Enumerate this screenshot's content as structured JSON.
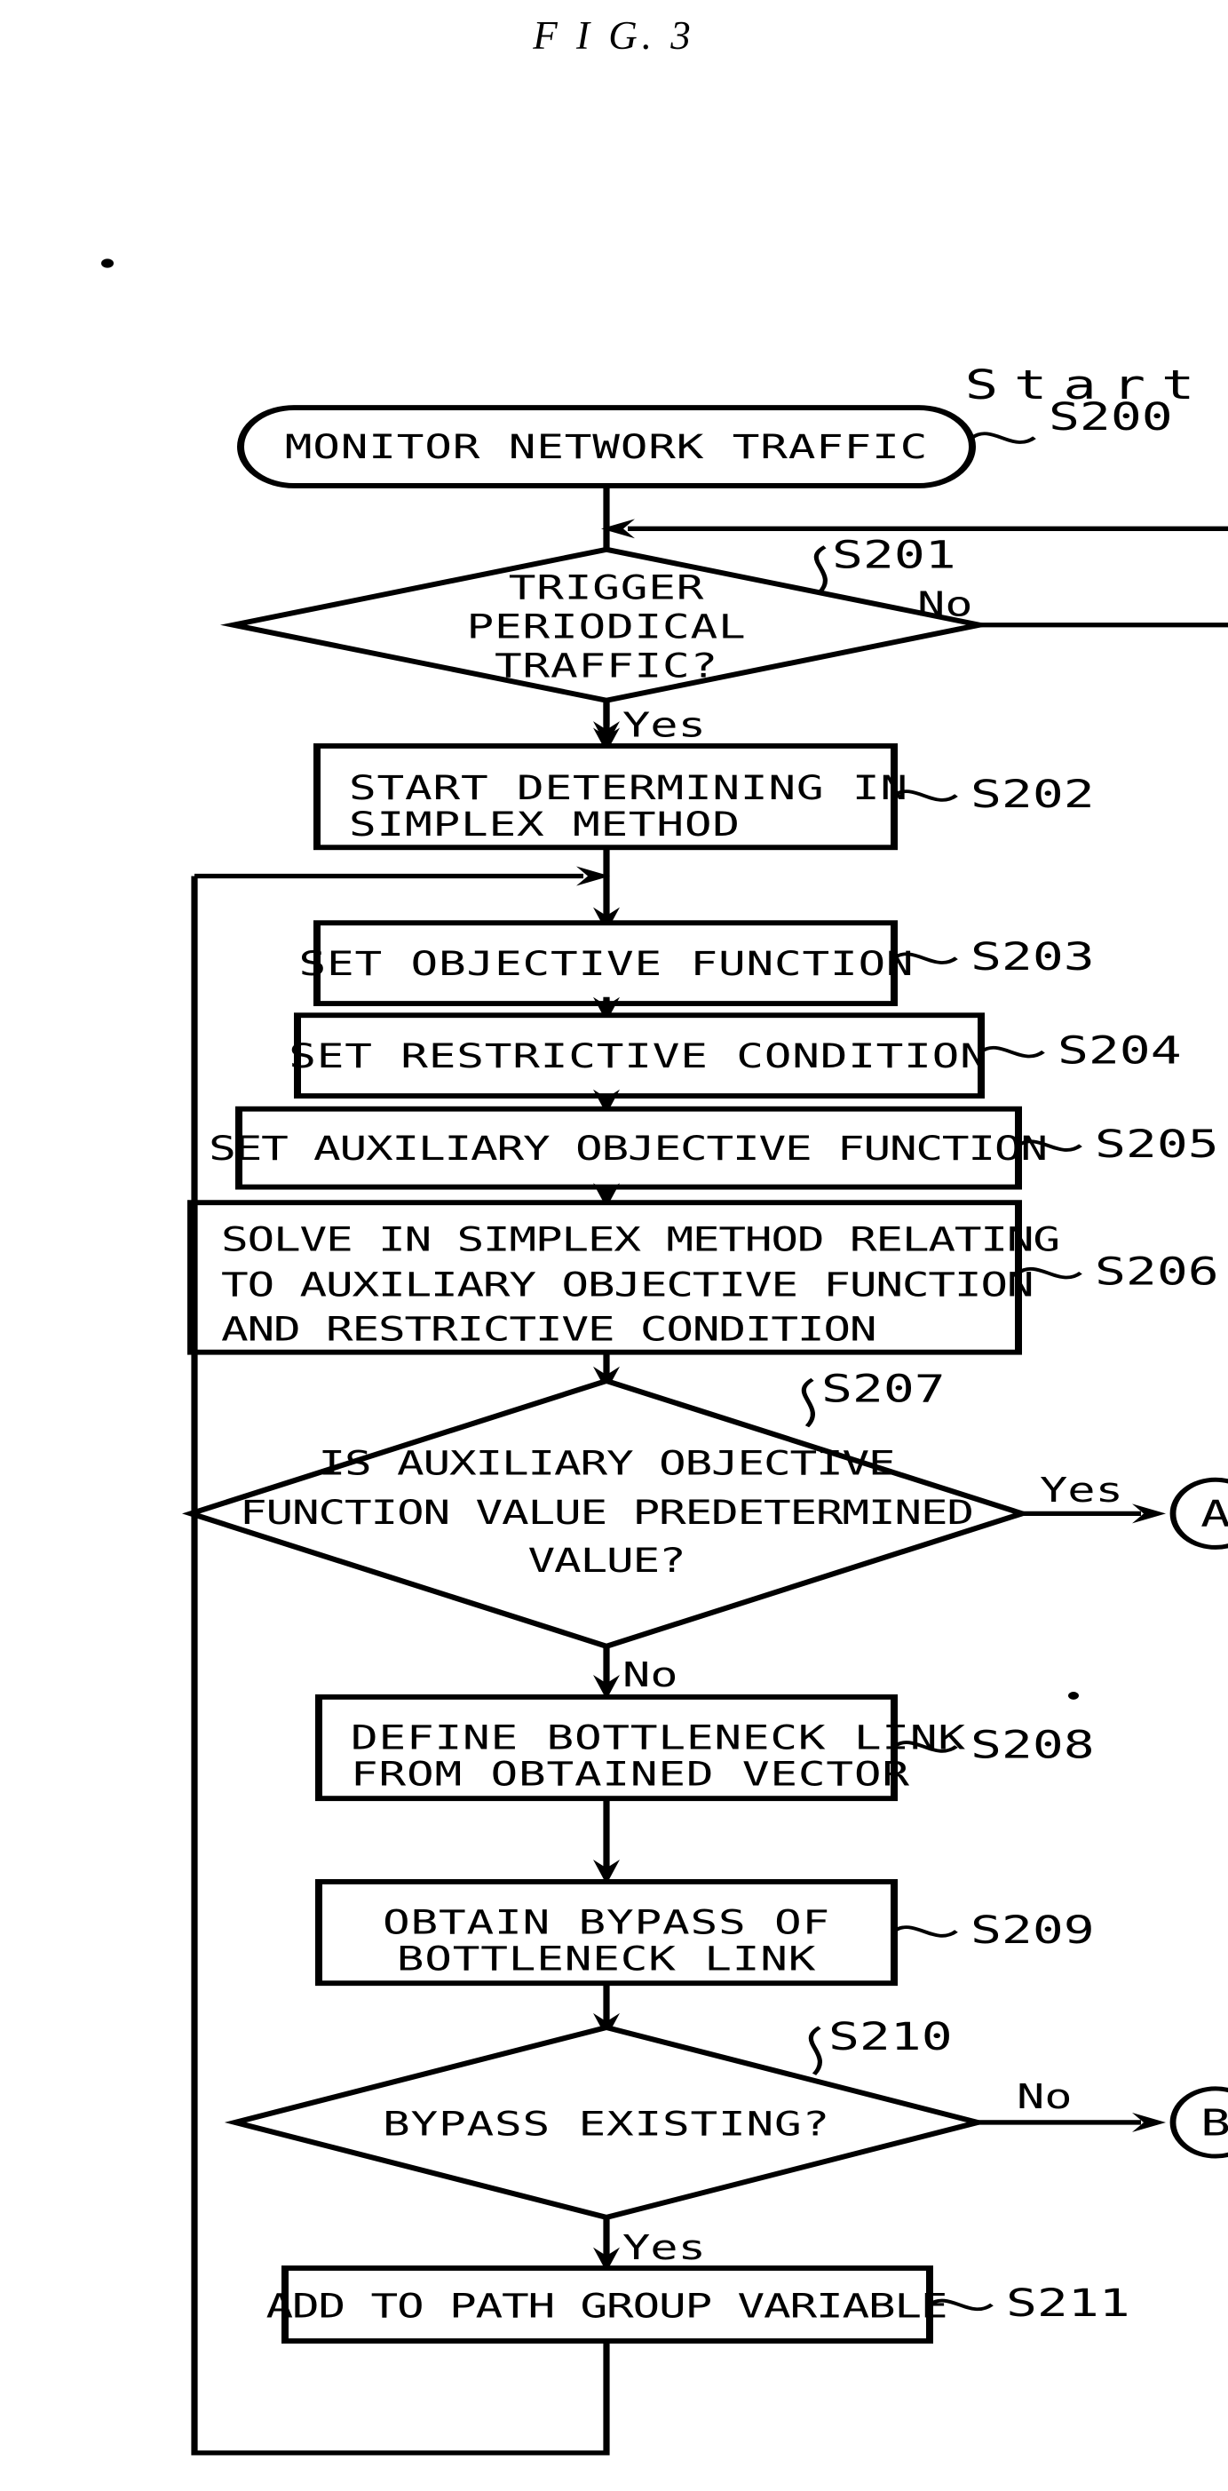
{
  "figure": {
    "title": "F I G. 3",
    "start_label": "Start"
  },
  "nodes": [
    {
      "id": "S200",
      "step": "S200",
      "shape": "terminator",
      "lines": [
        "MONITOR NETWORK TRAFFIC"
      ]
    },
    {
      "id": "S201",
      "step": "S201",
      "shape": "decision",
      "lines": [
        "TRIGGER",
        "PERIODICAL",
        "TRAFFIC?"
      ],
      "branch_no": "No",
      "branch_yes": "Yes"
    },
    {
      "id": "S202",
      "step": "S202",
      "shape": "process",
      "lines": [
        "START DETERMINING IN",
        "SIMPLEX METHOD"
      ]
    },
    {
      "id": "S203",
      "step": "S203",
      "shape": "process",
      "lines": [
        "SET OBJECTIVE FUNCTION"
      ]
    },
    {
      "id": "S204",
      "step": "S204",
      "shape": "process",
      "lines": [
        "SET RESTRICTIVE CONDITION"
      ]
    },
    {
      "id": "S205",
      "step": "S205",
      "shape": "process",
      "lines": [
        "SET AUXILIARY OBJECTIVE FUNCTION"
      ]
    },
    {
      "id": "S206",
      "step": "S206",
      "shape": "process",
      "lines": [
        "SOLVE IN SIMPLEX METHOD RELATING",
        "TO AUXILIARY OBJECTIVE FUNCTION",
        "AND RESTRICTIVE CONDITION"
      ]
    },
    {
      "id": "S207",
      "step": "S207",
      "shape": "decision",
      "lines": [
        "IS AUXILIARY OBJECTIVE",
        "FUNCTION VALUE PREDETERMINED",
        "VALUE?"
      ],
      "branch_yes": "Yes",
      "branch_no": "No",
      "connector": "A"
    },
    {
      "id": "S208",
      "step": "S208",
      "shape": "process",
      "lines": [
        "DEFINE BOTTLENECK LINK",
        "FROM OBTAINED VECTOR"
      ]
    },
    {
      "id": "S209",
      "step": "S209",
      "shape": "process",
      "lines": [
        "OBTAIN BYPASS OF",
        "BOTTLENECK LINK"
      ]
    },
    {
      "id": "S210",
      "step": "S210",
      "shape": "decision",
      "lines": [
        "BYPASS EXISTING?"
      ],
      "branch_no": "No",
      "branch_yes": "Yes",
      "connector": "B"
    },
    {
      "id": "S211",
      "step": "S211",
      "shape": "process",
      "lines": [
        "ADD TO PATH GROUP VARIABLE"
      ]
    }
  ],
  "connectors": {
    "a": "A",
    "b": "B"
  },
  "edge_labels": {
    "s201_no": "No",
    "s201_yes": "Yes",
    "s207_yes": "Yes",
    "s207_no": "No",
    "s210_no": "No",
    "s210_yes": "Yes"
  },
  "colors": {
    "ink": "#000000",
    "paper": "#ffffff"
  }
}
